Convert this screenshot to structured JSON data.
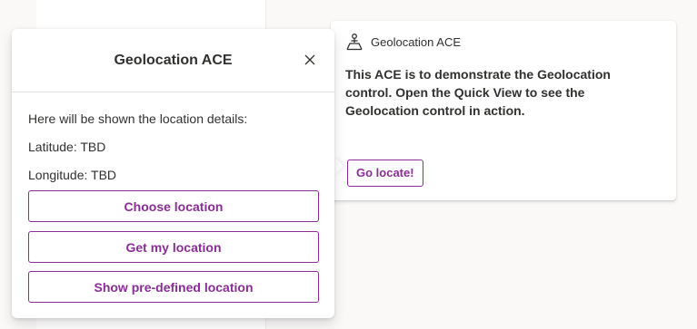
{
  "ace_card": {
    "title": "Geolocation ACE",
    "icon": "person-pin-icon",
    "description": "This ACE is to demonstrate the Geolocation control. Open the Quick View to see the Geolocation control in action.",
    "action_label": "Go locate!"
  },
  "quick_view": {
    "title": "Geolocation ACE",
    "intro": "Here will be shown the location details:",
    "latitude": "Latitude: TBD",
    "longitude": "Longitude: TBD",
    "buttons": [
      {
        "label": "Choose location"
      },
      {
        "label": "Get my location"
      },
      {
        "label": "Show pre-defined location"
      }
    ]
  },
  "colors": {
    "accent": "#8a2d96",
    "text": "#323130",
    "background": "#faf9f8"
  }
}
